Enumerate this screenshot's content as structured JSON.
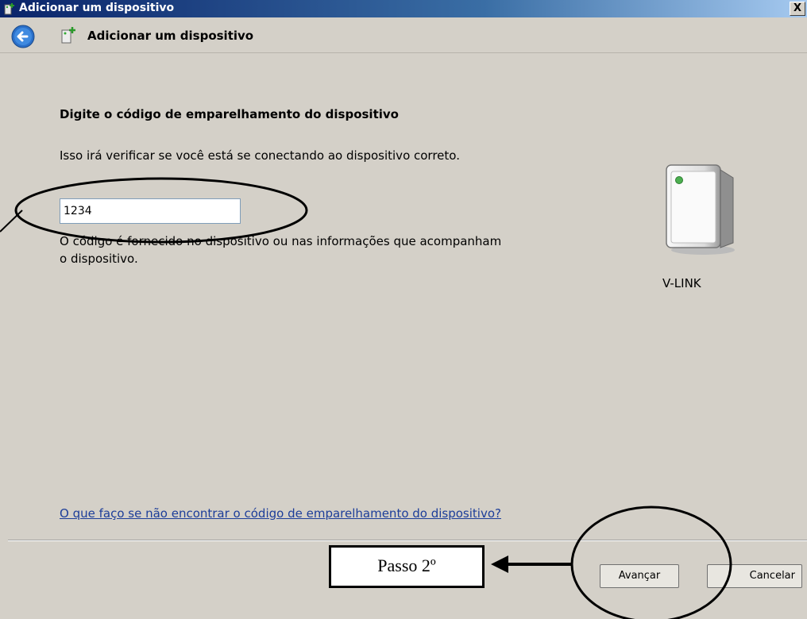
{
  "window": {
    "title": "Adicionar um dispositivo",
    "close_label": "X"
  },
  "nav": {
    "title": "Adicionar um dispositivo"
  },
  "content": {
    "heading": "Digite o código de emparelhamento do dispositivo",
    "description": "Isso irá verificar se você está se conectando ao dispositivo correto.",
    "code_value": "1234",
    "hint": "O código é fornecido no dispositivo ou nas informações que acompanham o dispositivo.",
    "device_name": "V-LINK",
    "help_link": "O que faço se não encontrar o código de emparelhamento do dispositivo?"
  },
  "footer": {
    "next_label": "Avançar",
    "cancel_label": "Cancelar"
  },
  "annotation": {
    "step_label": "Passo 2º"
  },
  "icons": {
    "back": "back-arrow-icon",
    "device": "device-tower-icon",
    "title": "add-device-icon"
  },
  "colors": {
    "window_bg": "#d4d0c8",
    "link": "#1c3d99",
    "title_bar": "#0a246a"
  }
}
